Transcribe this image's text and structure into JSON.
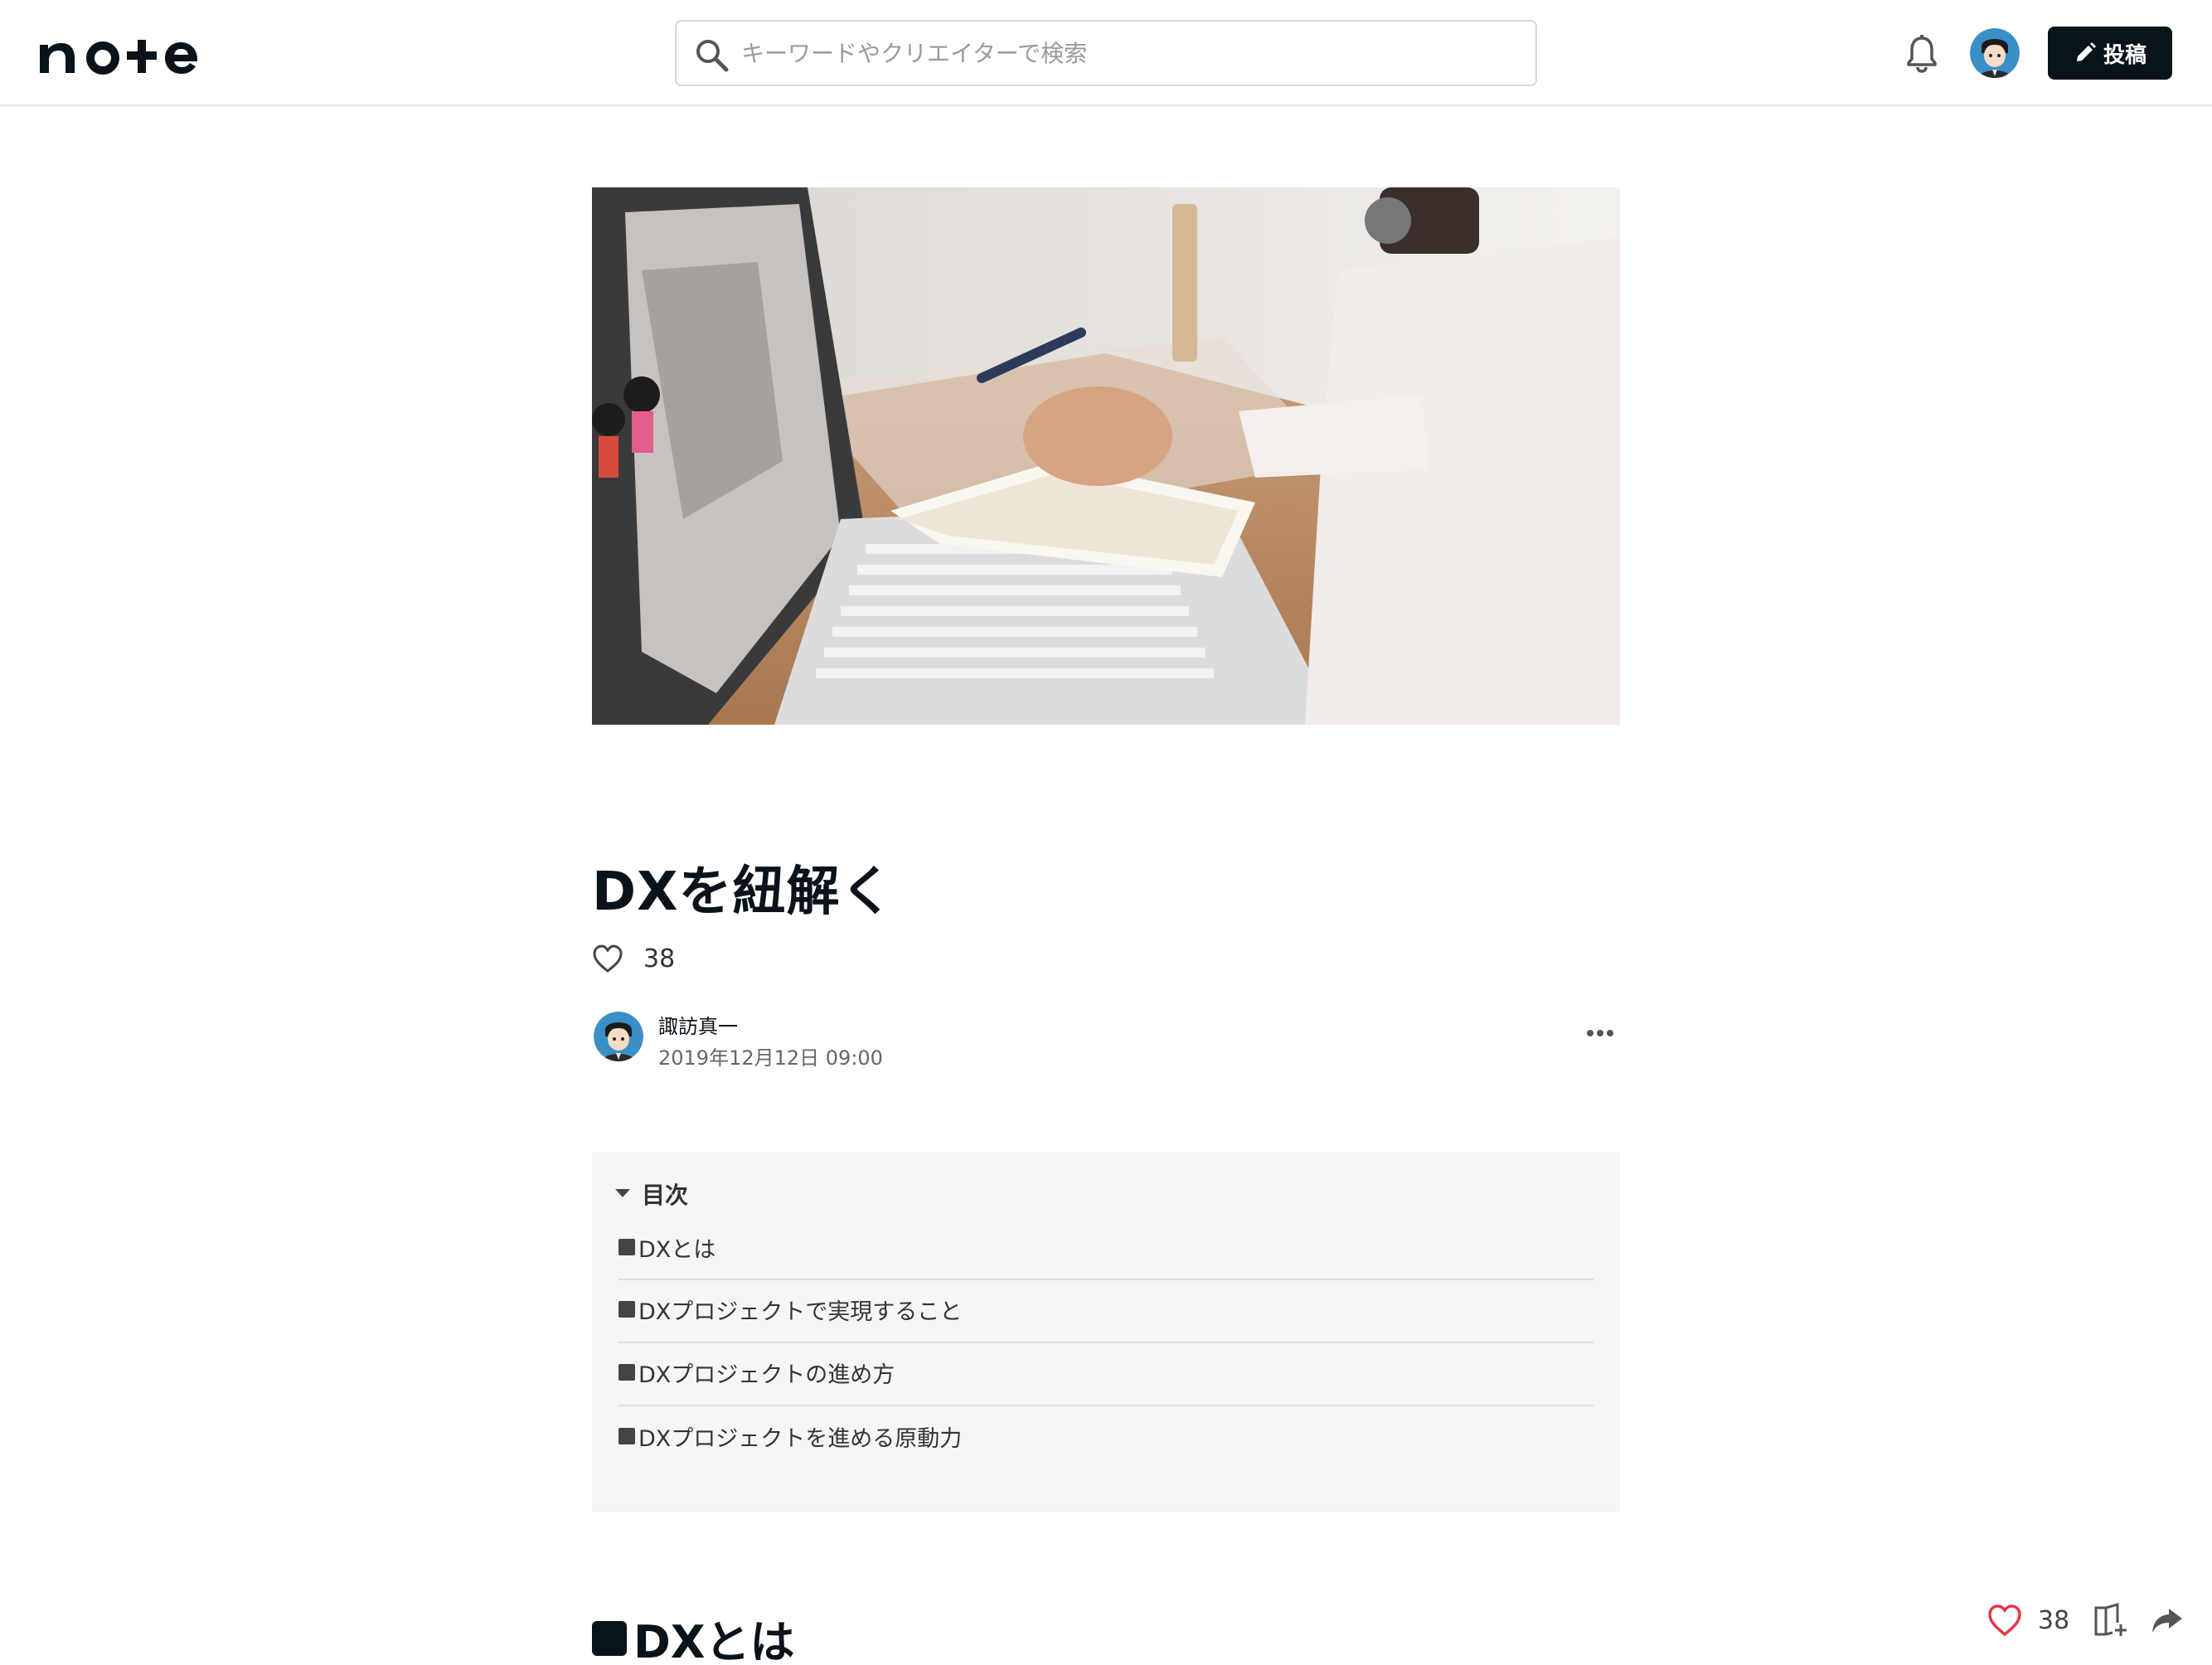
{
  "header": {
    "logo_text": "note",
    "search_placeholder": "キーワードやクリエイターで検索",
    "post_label": "投稿"
  },
  "article": {
    "title": "DXを紐解く",
    "like_count": "38",
    "author_name": "諏訪真一",
    "published": "2019年12月12日 09:00"
  },
  "toc": {
    "heading": "目次",
    "items": [
      {
        "label": "DXとは"
      },
      {
        "label": "DXプロジェクトで実現すること"
      },
      {
        "label": "DXプロジェクトの進め方"
      },
      {
        "label": "DXプロジェクトを進める原動力"
      }
    ]
  },
  "section": {
    "heading": "DXとは"
  },
  "floating_bar": {
    "like_count": "38"
  },
  "colors": {
    "text": "#08131a",
    "like_red": "#e3374c",
    "toc_bg": "#f4f6f8"
  }
}
